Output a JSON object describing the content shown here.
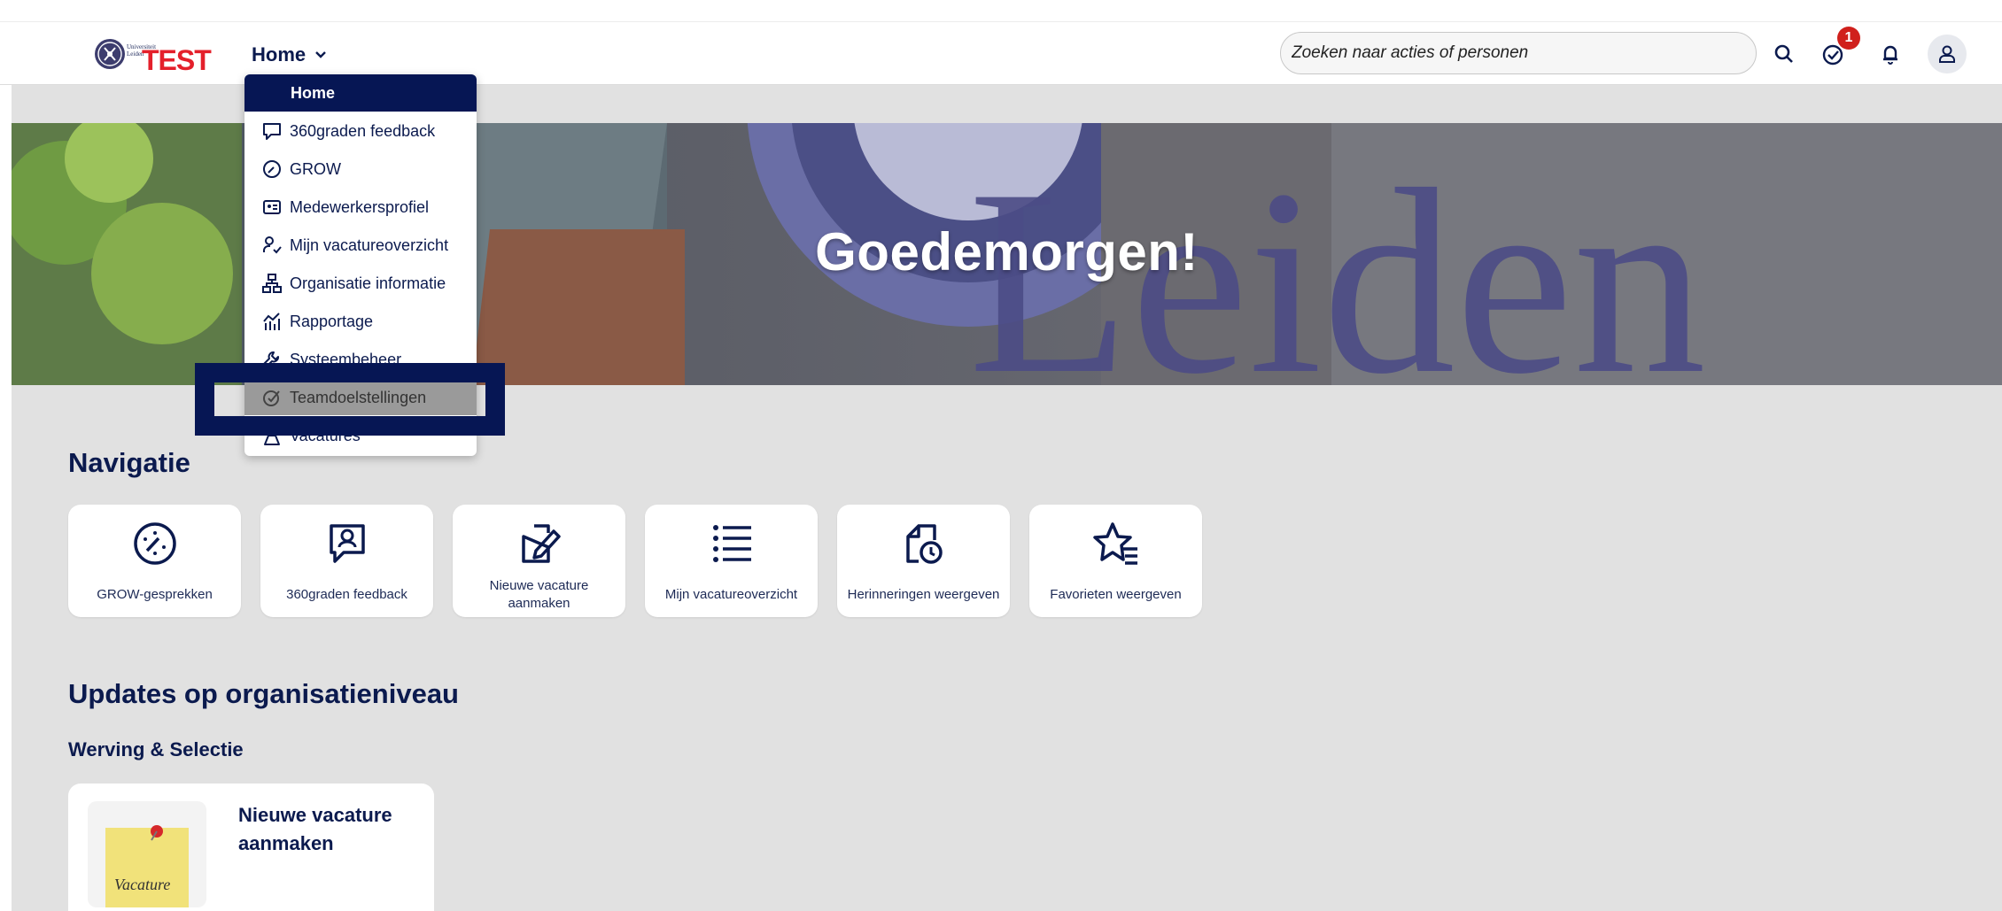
{
  "header": {
    "logo": {
      "university_text": "Universiteit Leiden",
      "test_label": "TEST"
    },
    "home_menu": "Home",
    "search": {
      "placeholder": "Zoeken naar acties of personen"
    },
    "notification_badge": "1"
  },
  "hero": {
    "greeting": "Goedemorgen!"
  },
  "dropdown": {
    "items": [
      {
        "label": "Home",
        "icon": "none",
        "state": "active"
      },
      {
        "label": "360graden feedback",
        "icon": "feedback-icon"
      },
      {
        "label": "GROW",
        "icon": "grow-icon"
      },
      {
        "label": "Medewerkersprofiel",
        "icon": "profile-card-icon"
      },
      {
        "label": "Mijn vacatureoverzicht",
        "icon": "person-check-icon"
      },
      {
        "label": "Organisatie informatie",
        "icon": "org-chart-icon"
      },
      {
        "label": "Rapportage",
        "icon": "report-chart-icon"
      },
      {
        "label": "Systeembeheer",
        "icon": "wrench-icon"
      },
      {
        "label": "Teamdoelstellingen",
        "icon": "target-icon",
        "state": "hover"
      },
      {
        "label": "Vacatures",
        "icon": "vacancy-icon"
      }
    ]
  },
  "navigatie": {
    "title": "Navigatie",
    "tiles": [
      {
        "label": "GROW-gesprekken",
        "icon": "grow-gauge-icon"
      },
      {
        "label": "360graden feedback",
        "icon": "feedback-bubble-icon"
      },
      {
        "label": "Nieuwe vacature aanmaken",
        "icon": "edit-document-icon"
      },
      {
        "label": "Mijn vacatureoverzicht",
        "icon": "list-icon"
      },
      {
        "label": "Herinneringen weergeven",
        "icon": "reminder-document-icon"
      },
      {
        "label": "Favorieten weergeven",
        "icon": "star-list-icon"
      }
    ]
  },
  "updates": {
    "title": "Updates op organisatieniveau",
    "subtitle": "Werving & Selectie",
    "card": {
      "title": "Nieuwe vacature aanmaken",
      "image_text": "Vacature"
    }
  },
  "colors": {
    "primary": "#061654",
    "text": "#0b1a4e",
    "badge": "#d0201c",
    "background": "#e1e1e1",
    "test_red": "#e4202b"
  }
}
